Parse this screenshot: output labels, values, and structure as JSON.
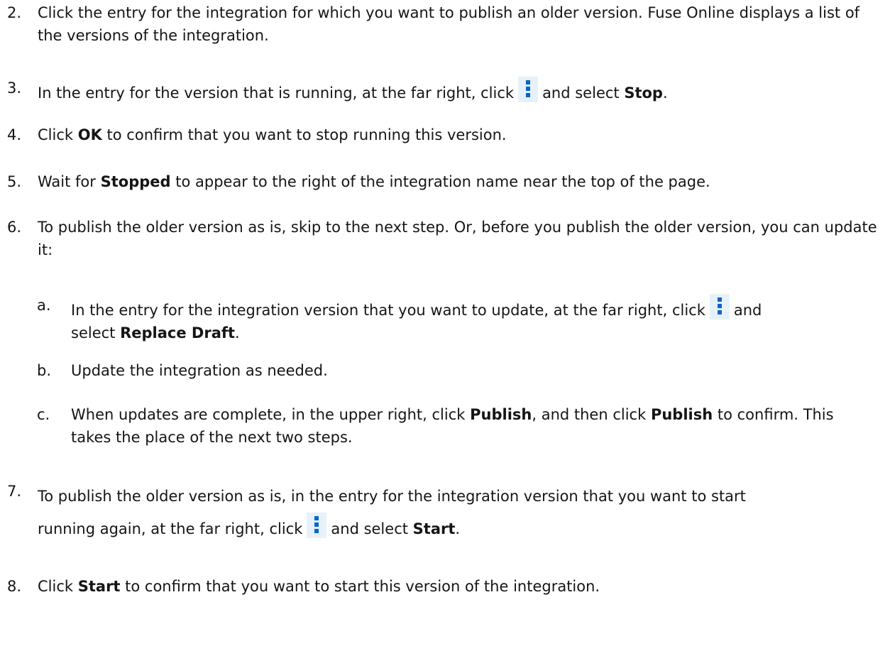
{
  "steps": [
    {
      "number": "2.",
      "text": "Click the entry for the integration for which you want to publish an older version. Fuse Online displays a list of the versions of the integration."
    },
    {
      "number": "3.",
      "before": "In the entry for the version that is running, at the far right, click",
      "after": "and select",
      "bold": "Stop",
      "end": "."
    },
    {
      "number": "4.",
      "before": "Click",
      "bold": "OK",
      "after": "to confirm that you want to stop running this version."
    },
    {
      "number": "5.",
      "before": "Wait for",
      "bold": "Stopped",
      "after": "to appear to the right of the integration name near the top of the page."
    },
    {
      "number": "6.",
      "text": "To publish the older version as is, skip to the next step. Or, before you publish the older version, you can update it:",
      "substeps": [
        {
          "letter": "a.",
          "before": "In the entry for the integration version that you want to update, at the far right, click",
          "after": "and",
          "line2": "select",
          "bold": "Replace Draft",
          "end": "."
        },
        {
          "letter": "b.",
          "text": "Update the integration as needed."
        },
        {
          "letter": "c.",
          "before": "When updates are complete, in the upper right, click",
          "bold1": "Publish",
          "middle": ", and then click",
          "bold2": "Publish",
          "after": "to confirm. This takes the place of the next two steps."
        }
      ]
    },
    {
      "number": "7.",
      "line1": "To publish the older version as is, in the entry for the integration version that you want to start",
      "line2_before": "running again, at the far right, click",
      "line2_after": "and select",
      "bold": "Start",
      "end": "."
    },
    {
      "number": "8.",
      "before": "Click",
      "bold": "Start",
      "after": "to confirm that you want to start this version of the integration."
    }
  ],
  "icons": {
    "kebab": "kebab-menu-icon",
    "kebab_color": "#0066cc",
    "kebab_bg": "#e7f1fa"
  }
}
